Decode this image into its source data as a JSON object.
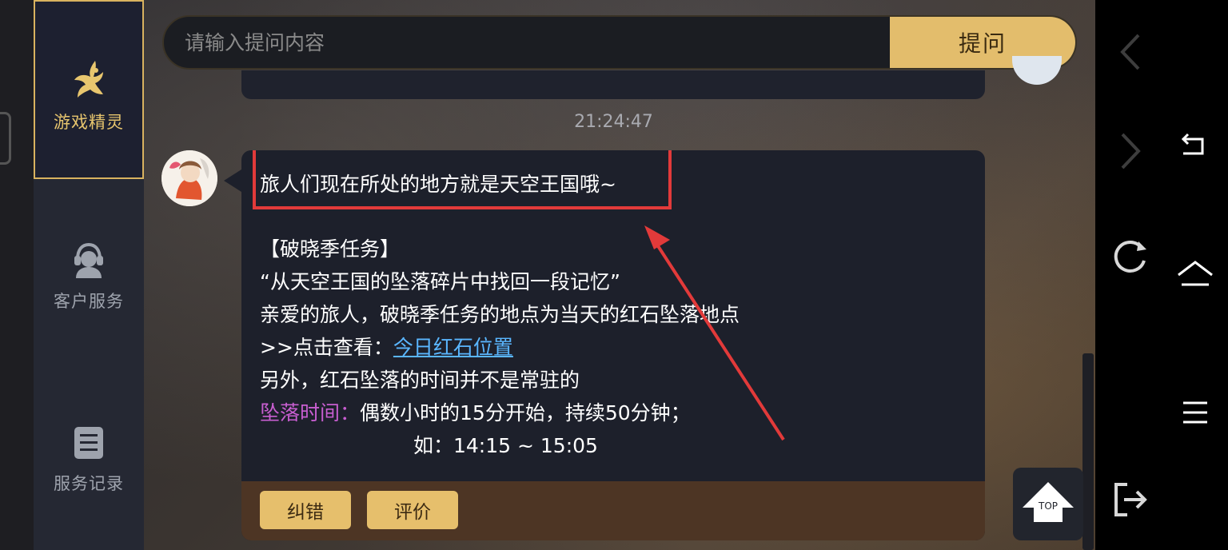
{
  "sidebar": {
    "items": [
      {
        "label": "游戏精灵",
        "icon": "fairy-icon",
        "active": true
      },
      {
        "label": "客户服务",
        "icon": "headset-agent-icon"
      },
      {
        "label": "服务记录",
        "icon": "list-record-icon"
      }
    ]
  },
  "search": {
    "placeholder": "请输入提问内容",
    "value": "",
    "button_label": "提问"
  },
  "chat": {
    "timestamp": "21:24:47",
    "message": {
      "line1": "旅人们现在所处的地方就是天空王国哦~",
      "line2": "【破晓季任务】",
      "line3": "“从天空王国的坠落碎片中找回一段记忆”",
      "line4": "亲爱的旅人，破晓季任务的地点为当天的红石坠落地点",
      "line5_prefix": ">>点击查看：",
      "line5_link": "今日红石位置",
      "line6": "另外，红石坠落的时间并不是常驻的",
      "line7_label": "坠落时间：",
      "line7_text": "偶数小时的15分开始，持续50分钟；",
      "line8": "如：14:15 ~ 15:05"
    },
    "footer": {
      "correct_label": "纠错",
      "rate_label": "评价"
    }
  },
  "top_button": {
    "label": "TOP"
  },
  "system_nav": {
    "icons": [
      "back-chevron-icon",
      "forward-chevron-icon",
      "refresh-icon",
      "exit-icon",
      "return-icon",
      "home-icon",
      "menu-icon"
    ]
  },
  "colors": {
    "accent": "#e3bd6c",
    "highlight": "#e23a3a",
    "link": "#5ab6ff",
    "label_pink": "#c85ed0"
  }
}
